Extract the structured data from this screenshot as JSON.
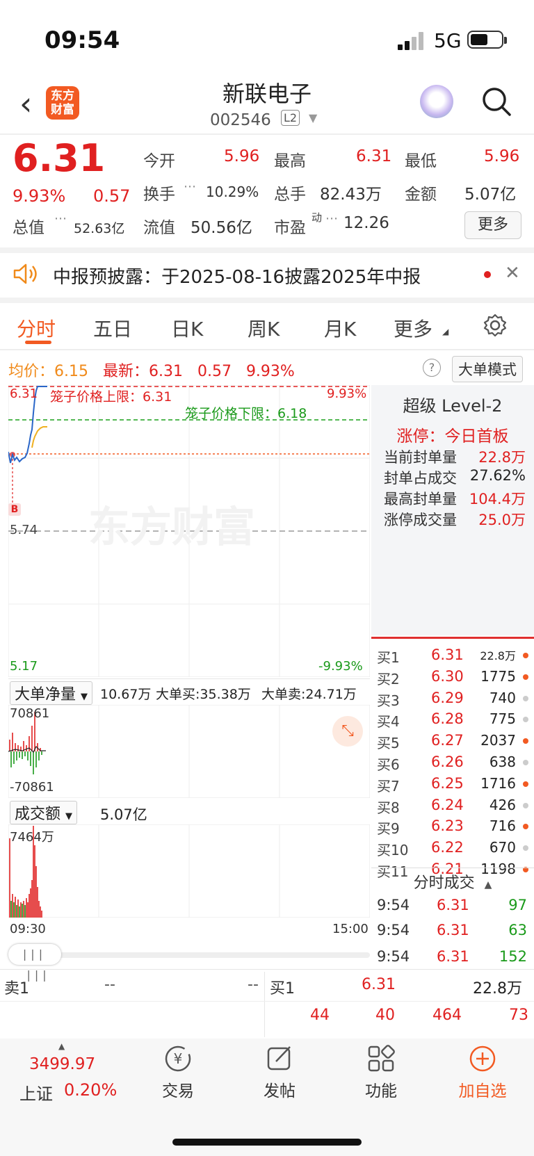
{
  "status_bar": {
    "time": "09:54",
    "network": "5G"
  },
  "header": {
    "logo_text": "东方财富",
    "stock_name": "新联电子",
    "stock_code": "002546",
    "level_badge": "L2"
  },
  "quote": {
    "price": "6.31",
    "change_pct": "9.93%",
    "change": "0.57",
    "fields": [
      {
        "label": "今开",
        "value": "5.96",
        "color": "#e02020"
      },
      {
        "label": "最高",
        "value": "6.31",
        "color": "#e02020"
      },
      {
        "label": "最低",
        "value": "5.96",
        "color": "#e02020"
      },
      {
        "label": "换手",
        "value": "10.29%",
        "color": "#333333"
      },
      {
        "label": "总手",
        "value": "82.43万",
        "color": "#333333"
      },
      {
        "label": "金额",
        "value": "5.07亿",
        "color": "#333333"
      },
      {
        "label": "总值",
        "value": "52.63亿",
        "color": "#333333"
      },
      {
        "label": "流值",
        "value": "50.56亿",
        "color": "#333333"
      },
      {
        "label": "市盈",
        "sup": "动",
        "value": "12.26",
        "color": "#333333"
      }
    ],
    "more_label": "更多"
  },
  "announcement": {
    "text": "中报预披露：于2025-08-16披露2025年中报"
  },
  "tabs": [
    "分时",
    "五日",
    "日K",
    "周K",
    "月K",
    "更多"
  ],
  "info_line": {
    "avg_label": "均价：",
    "avg_value": "6.15",
    "latest_label": "最新：",
    "latest_value": "6.31",
    "latest_change": "0.57",
    "latest_pct": "9.93%",
    "big_order_mode": "大单模式"
  },
  "chart": {
    "price_high": "6.31",
    "pct_high": "9.93%",
    "price_low": "5.17",
    "pct_low": "-9.93%",
    "prev_close": "5.74",
    "upper_cage": "笼子价格上限：6.31",
    "lower_cage": "笼子价格下限：6.18",
    "marker": "B",
    "watermark": "东方财富",
    "time_start": "09:30",
    "time_end": "15:00"
  },
  "level2": {
    "title": "超级 Level-2",
    "limit_up": "涨停：今日首板",
    "stats": [
      {
        "label": "当前封单量",
        "value": "22.8万"
      },
      {
        "label": "封单占成交",
        "value": "27.62%"
      },
      {
        "label": "最高封单量",
        "value": "104.4万"
      },
      {
        "label": "涨停成交量",
        "value": "25.0万"
      }
    ]
  },
  "bids": [
    {
      "label": "买1",
      "price": "6.31",
      "vol": "22.8万",
      "dot": "#f25a22"
    },
    {
      "label": "买2",
      "price": "6.30",
      "vol": "1775",
      "dot": "#f25a22"
    },
    {
      "label": "买3",
      "price": "6.29",
      "vol": "740",
      "dot": "#cccccc"
    },
    {
      "label": "买4",
      "price": "6.28",
      "vol": "775",
      "dot": "#cccccc"
    },
    {
      "label": "买5",
      "price": "6.27",
      "vol": "2037",
      "dot": "#f25a22"
    },
    {
      "label": "买6",
      "price": "6.26",
      "vol": "638",
      "dot": "#cccccc"
    },
    {
      "label": "买7",
      "price": "6.25",
      "vol": "1716",
      "dot": "#f25a22"
    },
    {
      "label": "买8",
      "price": "6.24",
      "vol": "426",
      "dot": "#cccccc"
    },
    {
      "label": "买9",
      "price": "6.23",
      "vol": "716",
      "dot": "#f25a22"
    },
    {
      "label": "买10",
      "price": "6.22",
      "vol": "670",
      "dot": "#cccccc"
    },
    {
      "label": "买11",
      "price": "6.21",
      "vol": "1198",
      "dot": "#f25a22"
    }
  ],
  "ticks": {
    "title": "分时成交",
    "rows": [
      {
        "time": "9:54",
        "price": "6.31",
        "vol": "97"
      },
      {
        "time": "9:54",
        "price": "6.31",
        "vol": "63"
      },
      {
        "time": "9:54",
        "price": "6.31",
        "vol": "152"
      }
    ]
  },
  "net_big": {
    "selector": "大单净量",
    "value": "10.67万",
    "buy": "大单买:35.38万",
    "sell": "大单卖:24.71万",
    "max": "70861",
    "min": "-70861"
  },
  "turnover": {
    "selector": "成交额",
    "value": "5.07亿",
    "max": "7464万"
  },
  "book_line": {
    "sell_label": "卖1",
    "sell_price": "--",
    "sell_vol": "--",
    "buy_label": "买1",
    "buy_price": "6.31",
    "buy_vol": "22.8万",
    "queue": [
      "44",
      "40",
      "464",
      "73"
    ]
  },
  "bottom_nav": {
    "index_value": "3499.97",
    "index_name": "上证",
    "index_pct": "0.20%",
    "items": [
      {
        "label": "交易",
        "icon": "trade-icon"
      },
      {
        "label": "发帖",
        "icon": "post-icon"
      },
      {
        "label": "功能",
        "icon": "apps-icon"
      },
      {
        "label": "加自选",
        "icon": "add-icon"
      }
    ]
  }
}
